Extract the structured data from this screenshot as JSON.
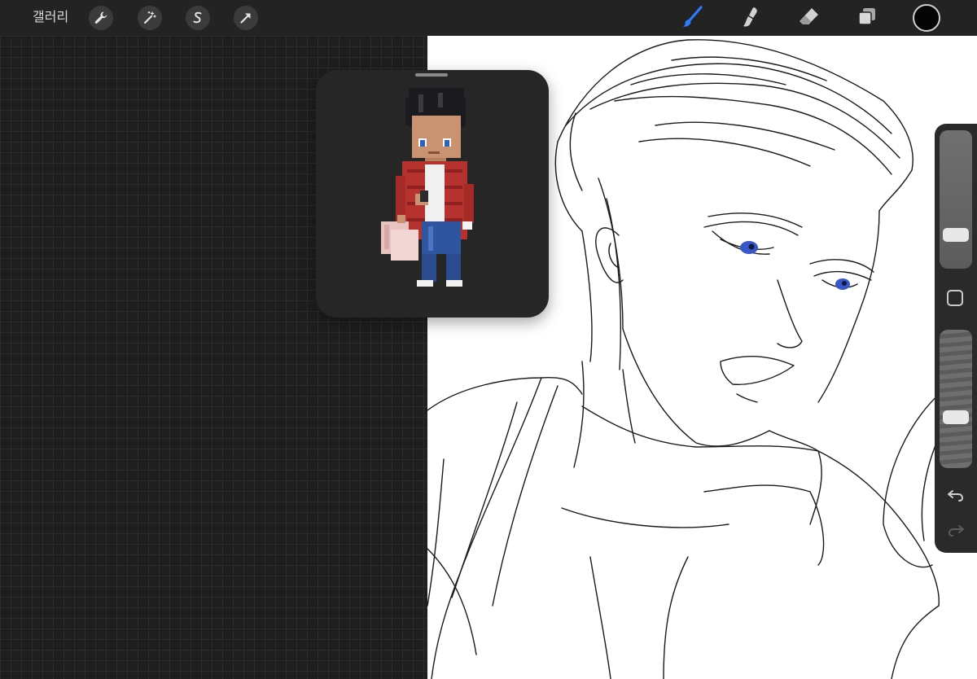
{
  "app": {
    "gallery_label": "갤러리"
  },
  "toolbar_left": {
    "actions_icon": "wrench-icon",
    "adjustments_icon": "magic-wand-icon",
    "selection_icon": "selection-s-icon",
    "transform_icon": "arrow-cursor-icon"
  },
  "toolbar_right": {
    "brush_icon": "brush-icon",
    "smudge_icon": "smudge-icon",
    "eraser_icon": "eraser-icon",
    "layers_icon": "layers-icon",
    "active_color": "#050505",
    "brush_accent": "#2f7bff"
  },
  "reference": {
    "content": "pixel-art-character"
  },
  "sidebar": {
    "brush_size_level": 0.79,
    "opacity_level": 0.5,
    "undo_icon": "undo-icon",
    "redo_icon": "redo-icon"
  }
}
